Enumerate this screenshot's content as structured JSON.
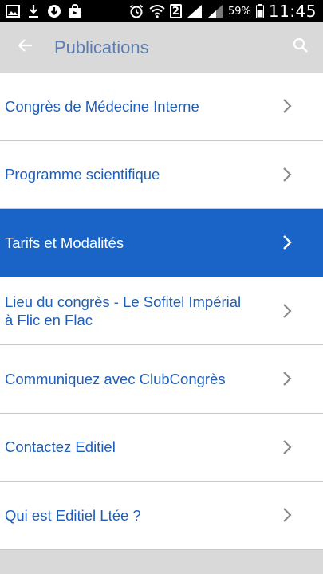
{
  "status_bar": {
    "icons_left": [
      "image-icon",
      "download-icon",
      "download-circle-icon",
      "bag-icon"
    ],
    "icons_right": [
      "alarm-icon",
      "wifi-icon",
      "signal-icon",
      "signal-icon"
    ],
    "sim_label": "2",
    "battery_percent": "59%",
    "time": "11:45"
  },
  "app_bar": {
    "title": "Publications",
    "background": "#d9d9d9",
    "title_color": "#5c7fb0"
  },
  "menu": {
    "accent": "#1a63c7",
    "items": [
      {
        "label": "Congrès de Médecine Interne",
        "active": false
      },
      {
        "label": "Programme scientifique",
        "active": false
      },
      {
        "label": "Tarifs et Modalités",
        "active": true
      },
      {
        "label": "Lieu du congrès - Le Sofitel Impérial à Flic en Flac",
        "active": false
      },
      {
        "label": "Communiquez avec ClubCongrès",
        "active": false
      },
      {
        "label": "Contactez Editiel",
        "active": false
      },
      {
        "label": "Qui est Editiel Ltée ?",
        "active": false
      }
    ]
  }
}
